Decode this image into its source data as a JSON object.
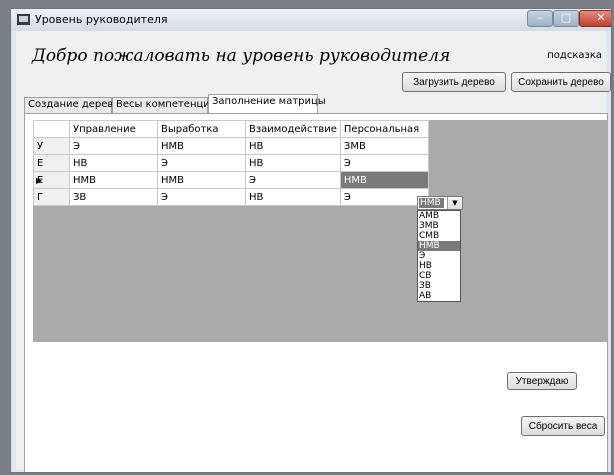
{
  "window": {
    "title": "Уровень руководителя"
  },
  "header": {
    "welcome": "Добро пожаловать на уровень руководителя",
    "hint": "подсказка"
  },
  "toolbar": {
    "load_tree": "Загрузить дерево",
    "save_tree": "Сохранить дерево"
  },
  "tabs": [
    {
      "label": "Создание дерева"
    },
    {
      "label": "Весы компетенций"
    },
    {
      "label": "Заполнение матрицы"
    }
  ],
  "grid": {
    "columns": [
      "Управление",
      "Выработка",
      "Взаимодействие",
      "Персональная"
    ],
    "rows": [
      {
        "header": "У",
        "cells": [
          "Э",
          "НМВ",
          "НВ",
          "ЗМВ"
        ]
      },
      {
        "header": "Е",
        "cells": [
          "НВ",
          "Э",
          "НВ",
          "Э"
        ]
      },
      {
        "header": "Е",
        "cells": [
          "НМВ",
          "НМВ",
          "Э",
          "НМВ"
        ]
      },
      {
        "header": "Г",
        "cells": [
          "ЗВ",
          "Э",
          "НВ",
          "Э"
        ]
      }
    ],
    "current_row_marker": "▶"
  },
  "dropdown": {
    "value": "НМВ",
    "options": [
      "АМВ",
      "ЗМВ",
      "СМВ",
      "НМВ",
      "Э",
      "НВ",
      "СВ",
      "ЗВ",
      "АВ"
    ]
  },
  "actions": {
    "approve": "Утверждаю",
    "reset_weights": "Сбросить веса"
  }
}
